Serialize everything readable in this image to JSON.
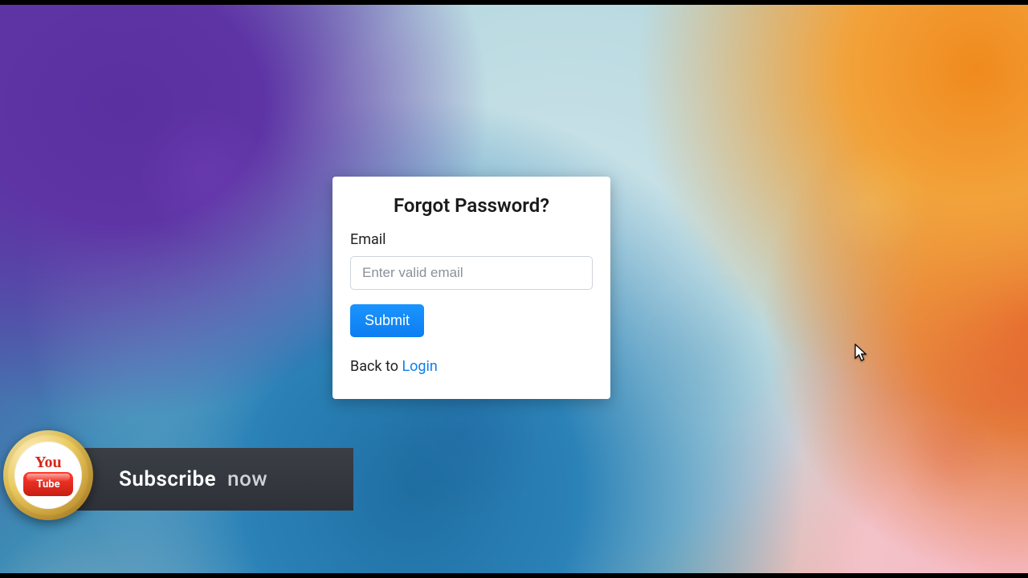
{
  "card": {
    "title": "Forgot Password?",
    "email_label": "Email",
    "email_placeholder": "Enter valid email",
    "email_value": "",
    "submit_label": "Submit",
    "back_prefix": "Back to ",
    "login_link": "Login"
  },
  "overlay": {
    "youtube_top": "You",
    "youtube_bottom": "Tube",
    "subscribe_word": "Subscribe",
    "now_word": "now"
  }
}
